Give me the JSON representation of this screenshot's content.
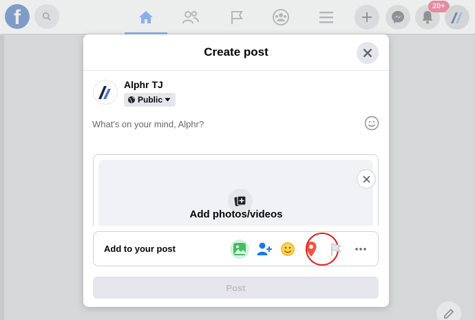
{
  "app": {
    "logo_letter": "f"
  },
  "nav": {
    "search_icon": "search-icon",
    "tabs": [
      {
        "icon": "home-icon",
        "active": true
      },
      {
        "icon": "friends-icon",
        "active": false
      },
      {
        "icon": "pages-flag-icon",
        "active": false
      },
      {
        "icon": "groups-icon",
        "active": false
      },
      {
        "icon": "menu-icon",
        "active": false
      }
    ],
    "actions": [
      "plus-icon",
      "messenger-icon",
      "bell-icon"
    ],
    "notification_count": "20+"
  },
  "modal": {
    "title": "Create post",
    "author": {
      "name": "Alphr TJ"
    },
    "audience": {
      "label": "Public"
    },
    "composer": {
      "placeholder": "What's on your mind, Alphr?"
    },
    "media": {
      "label": "Add photos/videos"
    },
    "add_to_post": {
      "label": "Add to your post",
      "icons": [
        "photo-video-icon",
        "tag-people-icon",
        "feeling-icon",
        "check-in-icon",
        "flag-icon",
        "more-icon"
      ],
      "highlighted": "check-in-icon"
    },
    "post_button": {
      "label": "Post",
      "enabled": false
    }
  },
  "colors": {
    "accent": "#1877f2",
    "photo_green": "#45bd62",
    "tag_blue": "#1877f2",
    "feeling_yellow": "#f7b928",
    "checkin_red": "#f5533d",
    "highlight_ring": "#e01f1f"
  }
}
